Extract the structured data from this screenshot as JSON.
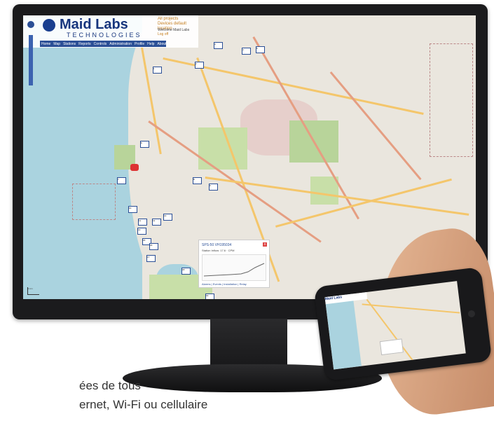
{
  "header": {
    "brand": "Maid Labs",
    "subbrand": "TECHNOLOGIES",
    "nav": [
      "Home",
      "Map",
      "Stations",
      "Reports",
      "Controls",
      "Administration",
      "Profile",
      "Help",
      "About"
    ],
    "project_links": [
      "All projects",
      "Devices default location"
    ],
    "welcome_label": "Welcome",
    "welcome_user": "Maid Labs",
    "logout": "Log off"
  },
  "popup": {
    "title": "SPS-50 VH195034",
    "info": "Station Inflow: 17.6 · CPM",
    "links": "Alarms | Events | Installation | Relay",
    "close": "x"
  },
  "map": {
    "scale_label": "1 km",
    "marker_labels": [
      "1",
      "2",
      "3",
      "4",
      "5",
      "6",
      "7",
      "8",
      "9",
      "10",
      "11",
      "12",
      "13",
      "14",
      "15",
      "16",
      "17",
      "18",
      "19"
    ]
  },
  "caption": {
    "line1": "ées de tous",
    "line2": "ernet, Wi-Fi ou cellulaire"
  },
  "phone": {
    "brand": "Maid Labs"
  }
}
